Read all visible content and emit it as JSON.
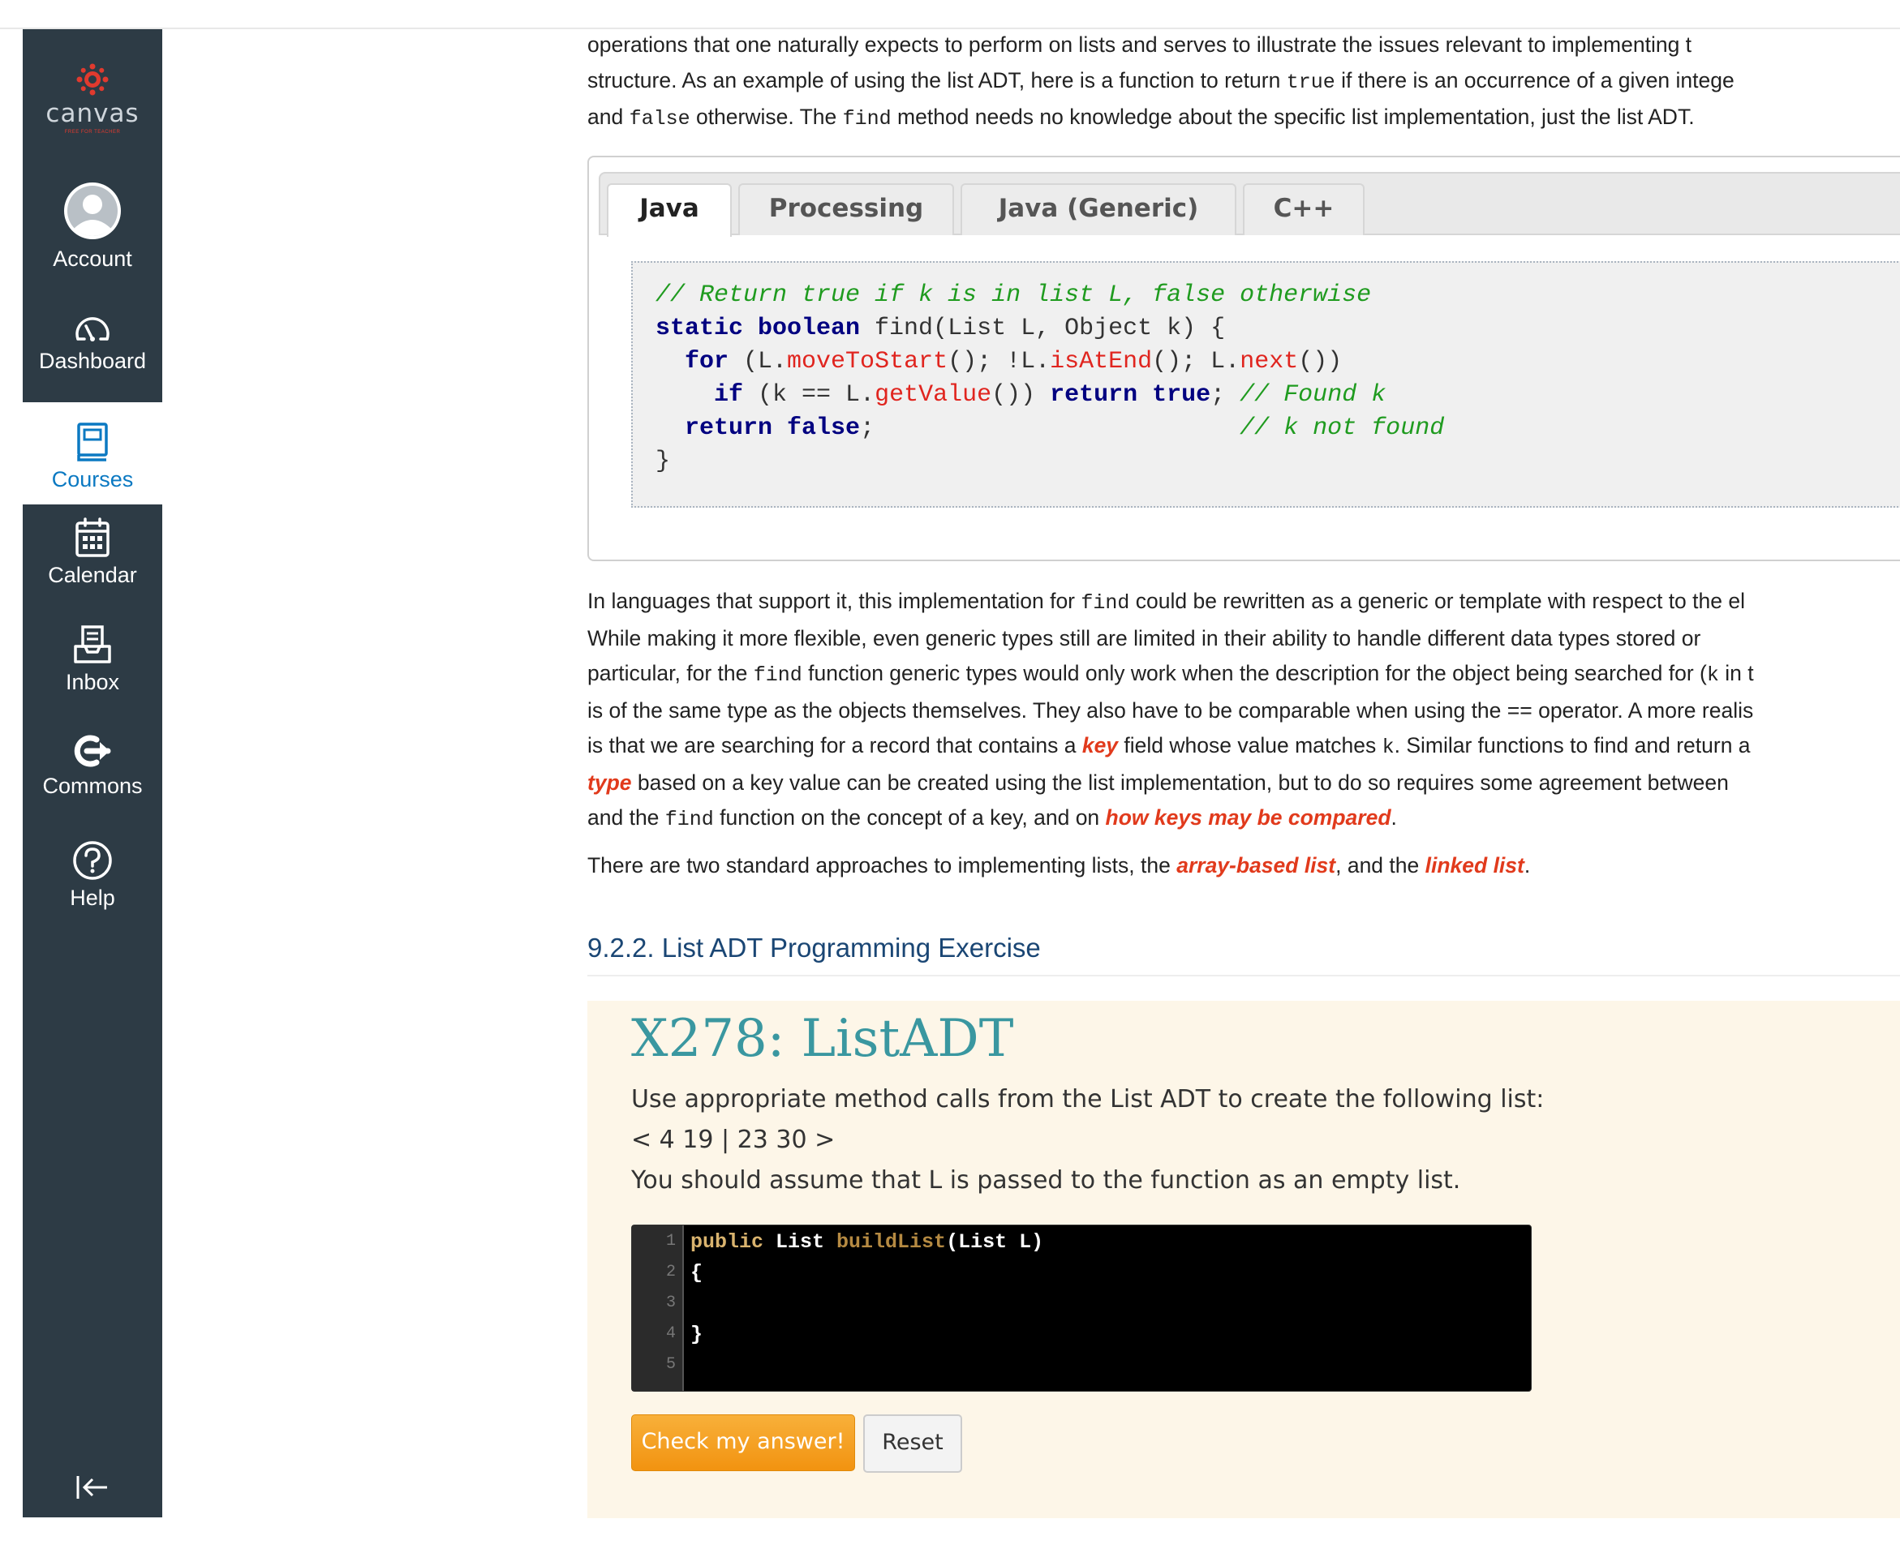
{
  "sidebar": {
    "logo": {
      "word": "canvas",
      "sub": "FREE FOR TEACHER"
    },
    "items": [
      {
        "label": "Account",
        "icon": "account-icon"
      },
      {
        "label": "Dashboard",
        "icon": "dashboard-icon"
      },
      {
        "label": "Courses",
        "icon": "courses-icon",
        "active": true
      },
      {
        "label": "Calendar",
        "icon": "calendar-icon"
      },
      {
        "label": "Inbox",
        "icon": "inbox-icon"
      },
      {
        "label": "Commons",
        "icon": "commons-icon"
      },
      {
        "label": "Help",
        "icon": "help-icon"
      }
    ],
    "collapse_icon": "collapse-icon",
    "colors": {
      "background": "#2d3b45",
      "active_text": "#0b79c2"
    }
  },
  "intro": {
    "line1": "operations that one naturally expects to perform on lists and serves to illustrate the issues relevant to implementing t",
    "line2_pre": "structure. As an example of using the list ADT, here is a function to return ",
    "line2_code": "true",
    "line2_post": " if there is an occurrence of a given intege",
    "line3_code1": "false",
    "line3_a": "and ",
    "line3_b": " otherwise. The ",
    "line3_code2": "find",
    "line3_c": " method needs no knowledge about the specific list implementation, just the list ADT."
  },
  "code_tabs": {
    "tabs": [
      "Java",
      "Processing",
      "Java (Generic)",
      "C++"
    ],
    "active": "Java",
    "code": {
      "l1": "// Return true if k is in list L, false otherwise",
      "l2_kw": "static boolean",
      "l2_rest": " find(List L, Object k) {",
      "l3_kw": "for",
      "l3_a": " (L.",
      "l3_f1": "moveToStart",
      "l3_b": "(); !L.",
      "l3_f2": "isAtEnd",
      "l3_c": "(); L.",
      "l3_f3": "next",
      "l3_d": "())",
      "l4_kw1": "if",
      "l4_a": " (k == L.",
      "l4_f": "getValue",
      "l4_b": "()) ",
      "l4_kw2": "return true",
      "l4_c": "; ",
      "l4_cm": "// Found k",
      "l5_kw": "return false",
      "l5_a": ";",
      "l5_cm": "// k not found",
      "l6": "}"
    }
  },
  "body": {
    "p1": {
      "l1_a": "In languages that support it, this implementation for ",
      "l1_code": "find",
      "l1_b": " could be rewritten as a generic or template with respect to the el",
      "l2": "While making it more flexible, even generic types still are limited in their ability to handle different data types stored or",
      "l3_a": "particular, for the ",
      "l3_code": "find",
      "l3_b": " function generic types would only work when the description for the object being searched for (",
      "l3_code2": "k",
      "l3_c": " in t",
      "l4": "is of the same type as the objects themselves. They also have to be comparable when using the == operator. A more realis",
      "l5_a": "is that we are searching for a record that contains a ",
      "l5_term": "key",
      "l5_b": " field whose value matches ",
      "l5_code": "k",
      "l5_c": ". Similar functions to find and return a",
      "l6_term": "type",
      "l6_a": " based on a key value can be created using the list implementation, but to do so requires some agreement between",
      "l7_a": "and the ",
      "l7_code": "find",
      "l7_b": " function on the concept of a key, and on ",
      "l7_term": "how keys may be compared",
      "l7_c": "."
    },
    "p2": {
      "a": "There are two standard approaches to implementing lists, the ",
      "term1": "array-based list",
      "b": ", and the ",
      "term2": "linked list",
      "c": "."
    }
  },
  "section": {
    "heading": "9.2.2. List ADT Programming Exercise"
  },
  "exercise": {
    "title": "X278: ListADT",
    "prompt": "Use appropriate method calls from the List ADT to create the following list:",
    "list": "< 4 19 | 23 30 >",
    "note": "You should assume that L is passed to the function as an empty list.",
    "editor": {
      "line_numbers": [
        "1",
        "2",
        "3",
        "4",
        "5"
      ],
      "l1_pub": "public",
      "l1_type": " List ",
      "l1_method": "buildList",
      "l1_args": "(List L)",
      "l2": "{",
      "l4": "}"
    },
    "check_button": "Check my answer!",
    "reset_button": "Reset"
  }
}
